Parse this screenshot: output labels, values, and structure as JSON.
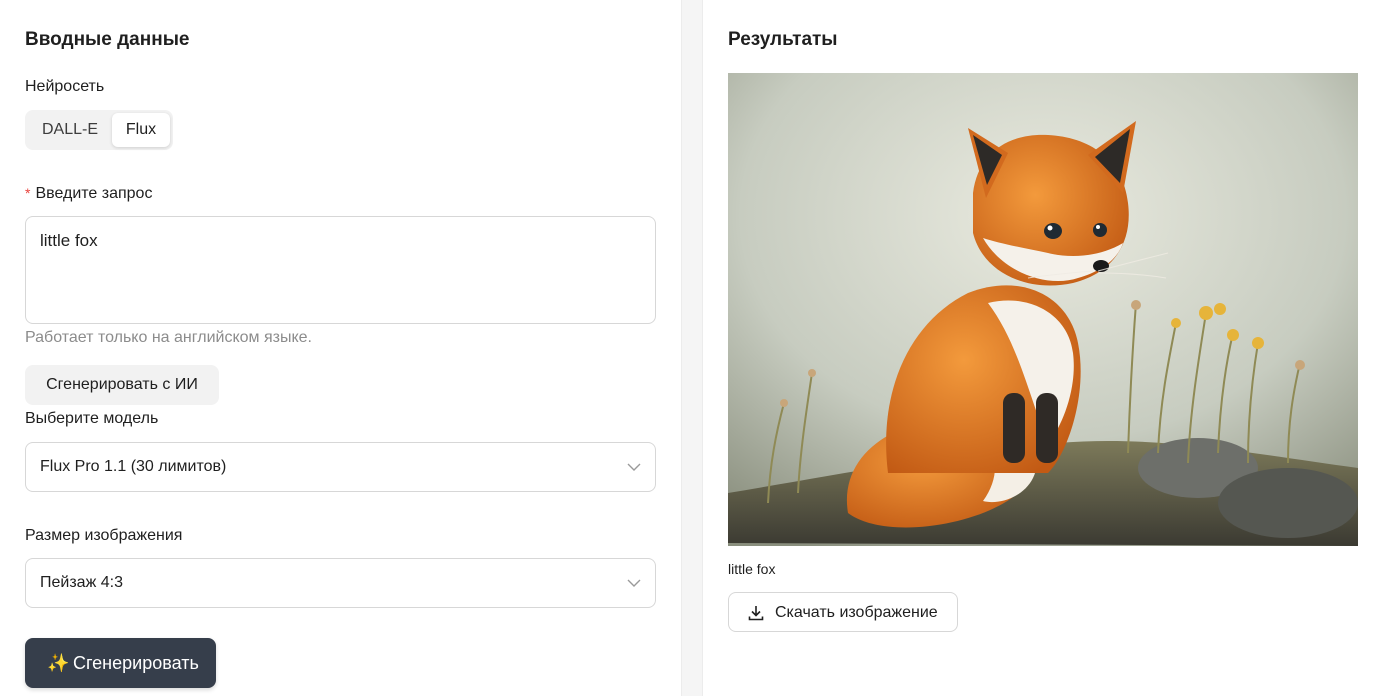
{
  "input_panel": {
    "title": "Вводные данные",
    "network_label": "Нейросеть",
    "network_options": [
      "DALL-E",
      "Flux"
    ],
    "network_selected": "Flux",
    "prompt_label": "Введите запрос",
    "prompt_required_mark": "*",
    "prompt_value": "little fox",
    "prompt_hint": "Работает только на английском языке.",
    "ai_generate_button": "Сгенерировать с ИИ",
    "model_label": "Выберите модель",
    "model_value": "Flux Pro 1.1 (30 лимитов)",
    "size_label": "Размер изображения",
    "size_value": "Пейзаж 4:3",
    "generate_button_icon": "✨",
    "generate_button": "Сгенерировать"
  },
  "result_panel": {
    "title": "Результаты",
    "image_caption": "little fox",
    "download_button": "Скачать изображение"
  },
  "icons": {
    "dropdown": "chevron-down-icon",
    "download": "download-icon",
    "sparkle": "sparkle-icon"
  },
  "colors": {
    "primary_button": "#363e4b",
    "required": "#e8413c",
    "hint_text": "#8c8c8c"
  }
}
